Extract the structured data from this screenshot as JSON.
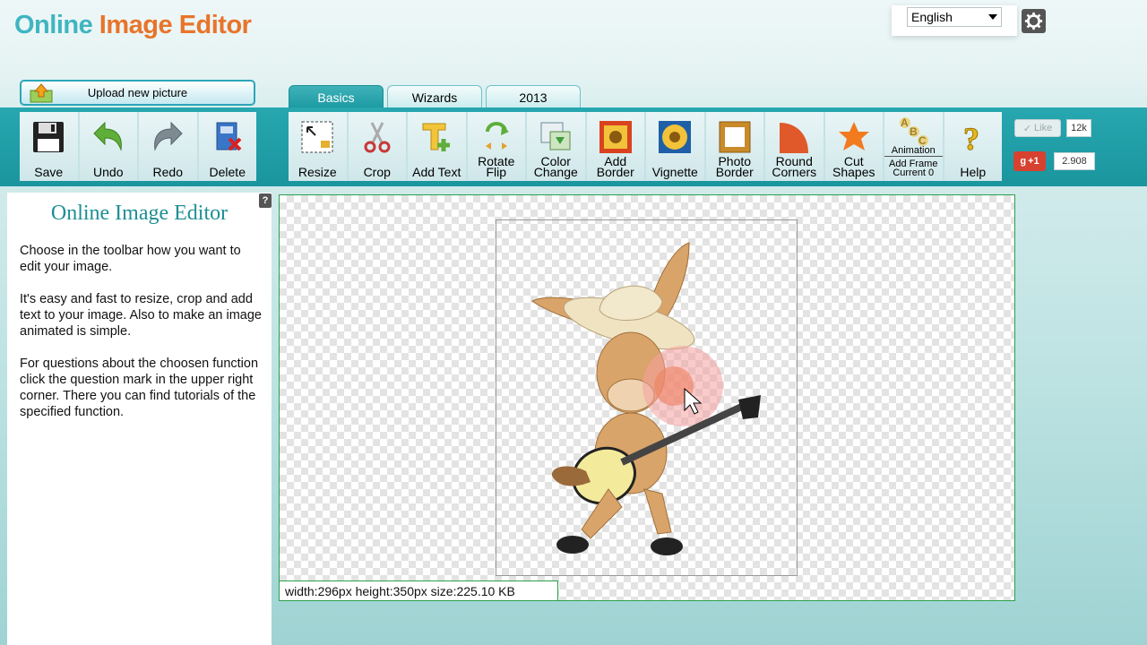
{
  "header": {
    "logo_part1": "Online",
    "logo_part2": "Image",
    "logo_part3": "Editor",
    "language": "English"
  },
  "upload": {
    "label": "Upload new picture"
  },
  "tabs": [
    {
      "label": "Basics",
      "active": true
    },
    {
      "label": "Wizards",
      "active": false
    },
    {
      "label": "2013",
      "active": false
    }
  ],
  "toolbar_left": [
    {
      "label": "Save",
      "icon": "floppy-disk-icon"
    },
    {
      "label": "Undo",
      "icon": "undo-arrow-icon"
    },
    {
      "label": "Redo",
      "icon": "redo-arrow-icon"
    },
    {
      "label": "Delete",
      "icon": "delete-file-icon"
    }
  ],
  "toolbar_main": [
    {
      "label": "Resize",
      "icon": "resize-icon"
    },
    {
      "label": "Crop",
      "icon": "scissors-icon"
    },
    {
      "label": "Add Text",
      "icon": "add-text-icon"
    },
    {
      "label": "Rotate\nFlip",
      "icon": "rotate-icon"
    },
    {
      "label": "Color\nChange",
      "icon": "color-change-icon"
    },
    {
      "label": "Add\nBorder",
      "icon": "add-border-icon"
    },
    {
      "label": "Vignette",
      "icon": "vignette-icon"
    },
    {
      "label": "Photo\nBorder",
      "icon": "photo-border-icon"
    },
    {
      "label": "Round\nCorners",
      "icon": "round-corners-icon"
    },
    {
      "label": "Cut\nShapes",
      "icon": "cut-shapes-icon"
    },
    {
      "label": "Add Frame\nCurrent 0",
      "icon": "animation-icon",
      "icon_label": "Animation"
    },
    {
      "label": "Help",
      "icon": "help-question-icon"
    }
  ],
  "social": {
    "like_label": "Like",
    "like_count": "12k",
    "gplus_label": "+1",
    "gplus_count": "2.908"
  },
  "panel": {
    "title": "Online Image Editor",
    "paragraphs": [
      "Choose in the toolbar how you want to edit your image.",
      "It's easy and fast to resize, crop and add text to your image. Also to make an image animated is simple.",
      "For questions about the choosen function click the question mark in the upper right corner. There you can find tutorials of the specified function."
    ]
  },
  "image_info": "width:296px  height:350px  size:225.10 KB",
  "colors": {
    "accent": "#1c9aa3",
    "logo_blue": "#3fb5c1",
    "logo_orange": "#e8742b",
    "canvas_border": "#2aa04a"
  }
}
